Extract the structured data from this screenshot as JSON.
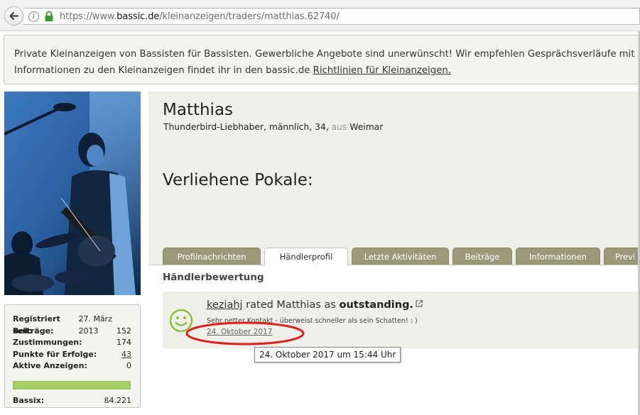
{
  "browser": {
    "url_prefix": "https://www.",
    "url_host": "bassic.de",
    "url_path": "/kleinanzeigen/traders/matthias.62740/"
  },
  "notice": {
    "line1": "Private Kleinanzeigen von Bassisten für Bassisten. Gewerbliche Angebote sind unerwünscht! Wir empfehlen Gesprächsverläufe mit Käufern",
    "line2_prefix": "Informationen zu den Kleinanzeigen findet ihr in den bassic.de ",
    "line2_link": "Richtlinien für Kleinanzeigen."
  },
  "stats": {
    "rows": [
      {
        "label": "Registriert seit:",
        "value": "27. März 2013"
      },
      {
        "label": "Beiträge:",
        "value": "152"
      },
      {
        "label": "Zustimmungen:",
        "value": "174"
      },
      {
        "label": "Punkte für Erfolge:",
        "value": "43"
      },
      {
        "label": "Aktive Anzeigen:",
        "value": "0"
      }
    ],
    "bassix_label": "Bassix:",
    "bassix_value": "ß4.221",
    "bar_fill_percent": 100,
    "bar_color": "#a6cf63"
  },
  "profile": {
    "name": "Matthias",
    "subtitle_main": "Thunderbird-Liebhaber, männlich, 34, ",
    "subtitle_muted": "aus",
    "subtitle_city": " Weimar",
    "trophies_title": "Verliehene Pokale:"
  },
  "tabs": [
    {
      "label": "Profilnachrichten",
      "active": false
    },
    {
      "label": "Händlerprofil",
      "active": true
    },
    {
      "label": "Letzte Aktivitäten",
      "active": false
    },
    {
      "label": "Beiträge",
      "active": false
    },
    {
      "label": "Informationen",
      "active": false
    },
    {
      "label": "Previ",
      "active": false
    }
  ],
  "trader": {
    "section_title": "Händlerbewertung",
    "rater": "keziahj",
    "rated_text": " rated Matthias as ",
    "rating": "outstanding.",
    "comment": "Sehr netter Kontakt - überweist schneller als sein Schatten! : )",
    "date": "24. Oktober 2017",
    "tooltip": "24. Oktober 2017 um 15:44 Uhr",
    "smiley_color": "#8cbf3a",
    "highlight_color": "#e02020"
  }
}
